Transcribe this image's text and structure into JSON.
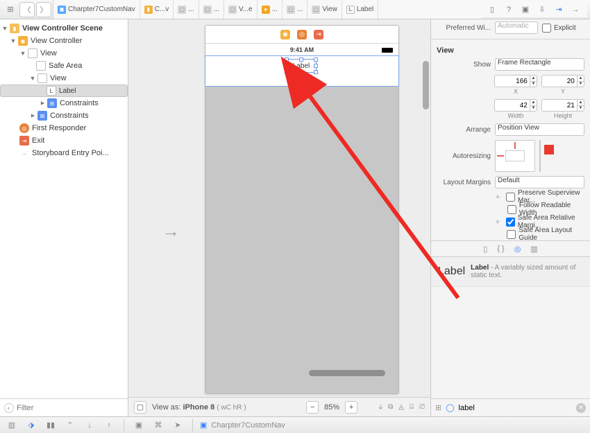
{
  "breadcrumb": [
    {
      "icon": "ci-blue",
      "label": "Charpter7CustomNav"
    },
    {
      "icon": "ci-yellow",
      "label": "C...v"
    },
    {
      "icon": "ci-gray",
      "label": "..."
    },
    {
      "icon": "ci-gray",
      "label": "..."
    },
    {
      "icon": "ci-gray",
      "label": "V...e"
    },
    {
      "icon": "ci-orange",
      "label": "..."
    },
    {
      "icon": "ci-gray",
      "label": "..."
    },
    {
      "icon": "ci-gray",
      "label": "View"
    },
    {
      "icon": "ci-text",
      "label": "Label"
    }
  ],
  "outline": {
    "scene": "View Controller Scene",
    "vc": "View Controller",
    "view1": "View",
    "safe": "Safe Area",
    "view2": "View",
    "label": "Label",
    "constraints": "Constraints",
    "constraints2": "Constraints",
    "first": "First Responder",
    "exit": "Exit",
    "entry": "Storyboard Entry Poi...",
    "filter_placeholder": "Filter"
  },
  "canvas": {
    "status_time": "9:41 AM",
    "selected_label_text": "Label",
    "viewas_prefix": "View as: ",
    "viewas_device": "iPhone 8 ",
    "viewas_traits": "( wC  hR )",
    "zoom": "85%"
  },
  "inspector": {
    "pref_width_label": "Preferred Wi...",
    "pref_width_value": "Automatic",
    "explicit": "Explicit",
    "view_header": "View",
    "show_label": "Show",
    "show_value": "Frame Rectangle",
    "x": "166",
    "y": "20",
    "w": "42",
    "h": "21",
    "xl": "X",
    "yl": "Y",
    "wl": "Width",
    "hl": "Height",
    "arrange_label": "Arrange",
    "arrange_value": "Position View",
    "autoresize_label": "Autoresizing",
    "margins_label": "Layout Margins",
    "margins_value": "Default",
    "opt_preserve": "Preserve Superview Mar...",
    "opt_readable": "Follow Readable Width",
    "opt_safearea_rel": "Safe Area Relative Margi...",
    "opt_safearea_guide": "Safe Area Layout Guide",
    "lib_lead": "Label",
    "lib_title": "Label",
    "lib_desc": " - A variably sized amount of static text.",
    "lib_filter_value": "label"
  },
  "bottom": {
    "project": "Charpter7CustomNav"
  }
}
